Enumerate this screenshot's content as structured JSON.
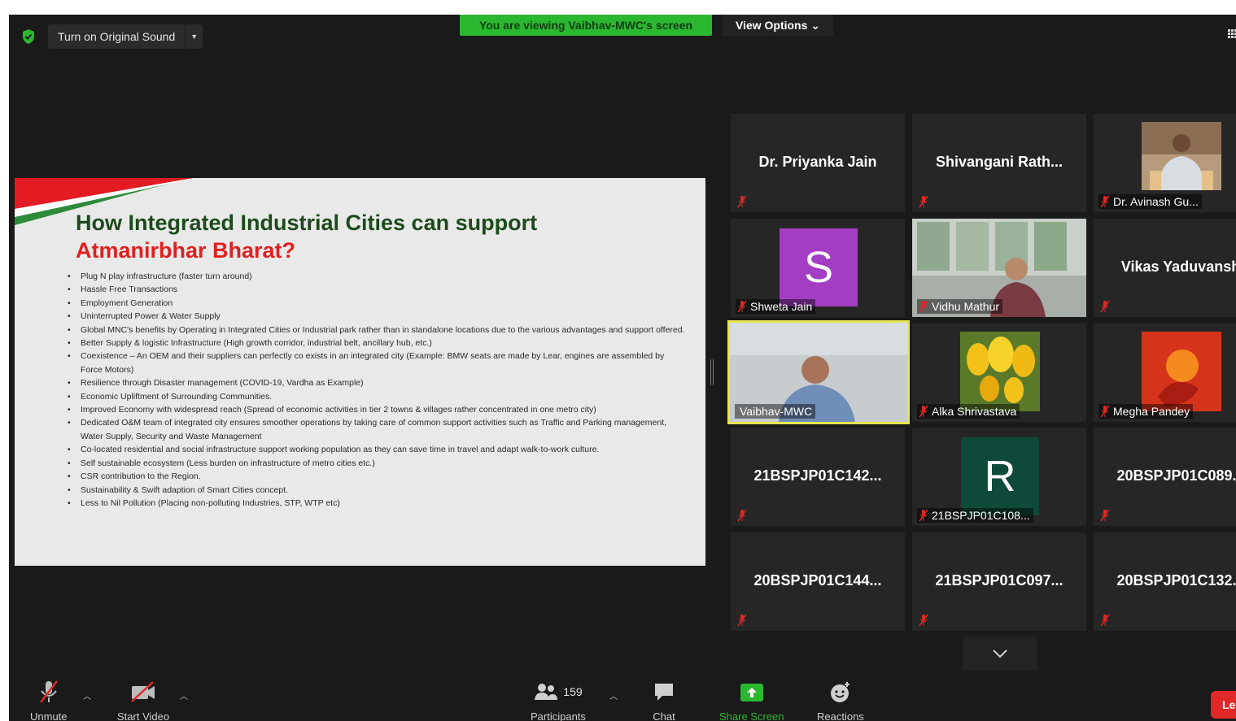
{
  "top": {
    "original_sound_label": "Turn on Original Sound",
    "viewing_banner": "You are viewing Vaibhav-MWC's screen",
    "view_options_label": "View Options ⌄"
  },
  "slide": {
    "title_line1": "How Integrated Industrial Cities can support",
    "title_line2": "Atmanirbhar Bharat?",
    "bullets": [
      "Plug N play infrastructure (faster turn around)",
      "Hassle Free Transactions",
      "Employment Generation",
      "Uninterrupted Power & Water Supply",
      "Global MNC's benefits by Operating in Integrated Cities or Industrial park rather than in standalone locations due to the various advantages and support offered.",
      "Better Supply & logistic Infrastructure (High growth corridor, industrial belt, ancillary hub, etc.)",
      "Coexistence – An OEM and their suppliers can perfectly co exists in an integrated city (Example: BMW seats are made by Lear, engines are assembled by Force Motors)",
      "Resilience through Disaster management (COVID-19, Vardha as Example)",
      "Economic Upliftment of Surrounding Communities.",
      "Improved Economy with widespread reach (Spread of economic activities in tier 2 towns & villages rather concentrated in one metro city)",
      "Dedicated O&M team of integrated city ensures smoother operations by taking care of common support activities such as Traffic and Parking management, Water Supply, Security and Waste Management",
      "Co-located residential and social infrastructure support working population as they can save time in travel and adapt walk-to-work culture.",
      "Self sustainable ecosystem (Less burden on infrastructure of metro cities etc.)",
      "CSR contribution to the Region.",
      "Sustainability & Swift adaption of Smart Cities concept.",
      "Less to Nil Pollution (Placing non-polluting Industries, STP, WTP etc)"
    ]
  },
  "participants": [
    {
      "big": "Dr. Priyanka Jain",
      "caption": ""
    },
    {
      "big": "Shivangani  Rath...",
      "caption": ""
    },
    {
      "big": "",
      "caption": "Dr. Avinash Gu..."
    },
    {
      "big": "",
      "caption": "Shweta Jain",
      "avatar_letter": "S",
      "avatar_color": "#a33ec4"
    },
    {
      "big": "",
      "caption": "Vidhu Mathur"
    },
    {
      "big": "Vikas Yaduvansh",
      "caption": ""
    },
    {
      "big": "",
      "caption": "Vaibhav-MWC"
    },
    {
      "big": "",
      "caption": "Alka Shrivastava"
    },
    {
      "big": "",
      "caption": "Megha Pandey"
    },
    {
      "big": "21BSPJP01C142...",
      "caption": ""
    },
    {
      "big": "",
      "caption": "21BSPJP01C108...",
      "avatar_letter": "R",
      "avatar_color": "#0e4a3a"
    },
    {
      "big": "20BSPJP01C089...",
      "caption": ""
    },
    {
      "big": "20BSPJP01C144...",
      "caption": ""
    },
    {
      "big": "21BSPJP01C097...",
      "caption": ""
    },
    {
      "big": "20BSPJP01C132...",
      "caption": ""
    }
  ],
  "toolbar": {
    "unmute": "Unmute",
    "start_video": "Start Video",
    "participants": "Participants",
    "participants_count": "159",
    "chat": "Chat",
    "share_screen": "Share Screen",
    "reactions": "Reactions",
    "leave": "Le"
  },
  "colors": {
    "share_green": "#2bb730",
    "speaker_border": "#e8e552",
    "muted_red": "#e02828",
    "leave_red": "#e02828"
  }
}
